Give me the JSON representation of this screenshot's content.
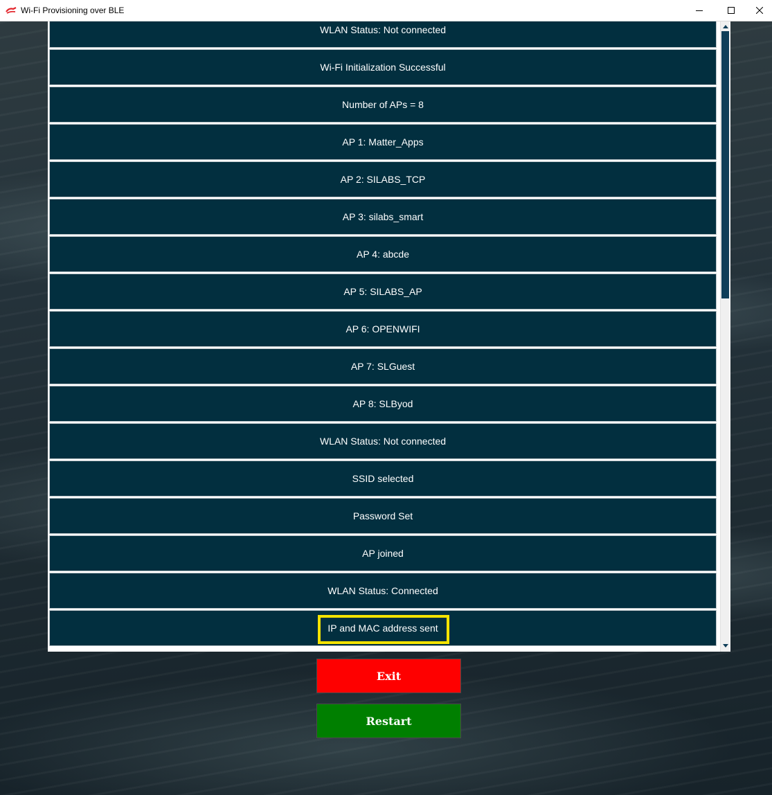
{
  "window": {
    "title": "Wi-Fi Provisioning over BLE"
  },
  "log": {
    "items": [
      "WLAN Status: Not connected",
      "Wi-Fi Initialization Successful",
      "Number of APs = 8",
      "AP 1: Matter_Apps",
      "AP 2: SILABS_TCP",
      "AP 3: silabs_smart",
      "AP 4: abcde",
      "AP 5: SILABS_AP",
      "AP 6: OPENWIFI",
      "AP 7: SLGuest",
      "AP 8: SLByod",
      "WLAN Status: Not connected",
      "SSID selected",
      "Password Set",
      "AP joined",
      "WLAN Status: Connected",
      "IP and MAC address sent"
    ],
    "highlighted_item": "IP and MAC address sent",
    "highlight_color": "#f4e300",
    "row_color": "#022f3f"
  },
  "buttons": {
    "exit_label": "Exit",
    "exit_color": "#fe0000",
    "restart_label": "Restart",
    "restart_color": "#007f00"
  }
}
